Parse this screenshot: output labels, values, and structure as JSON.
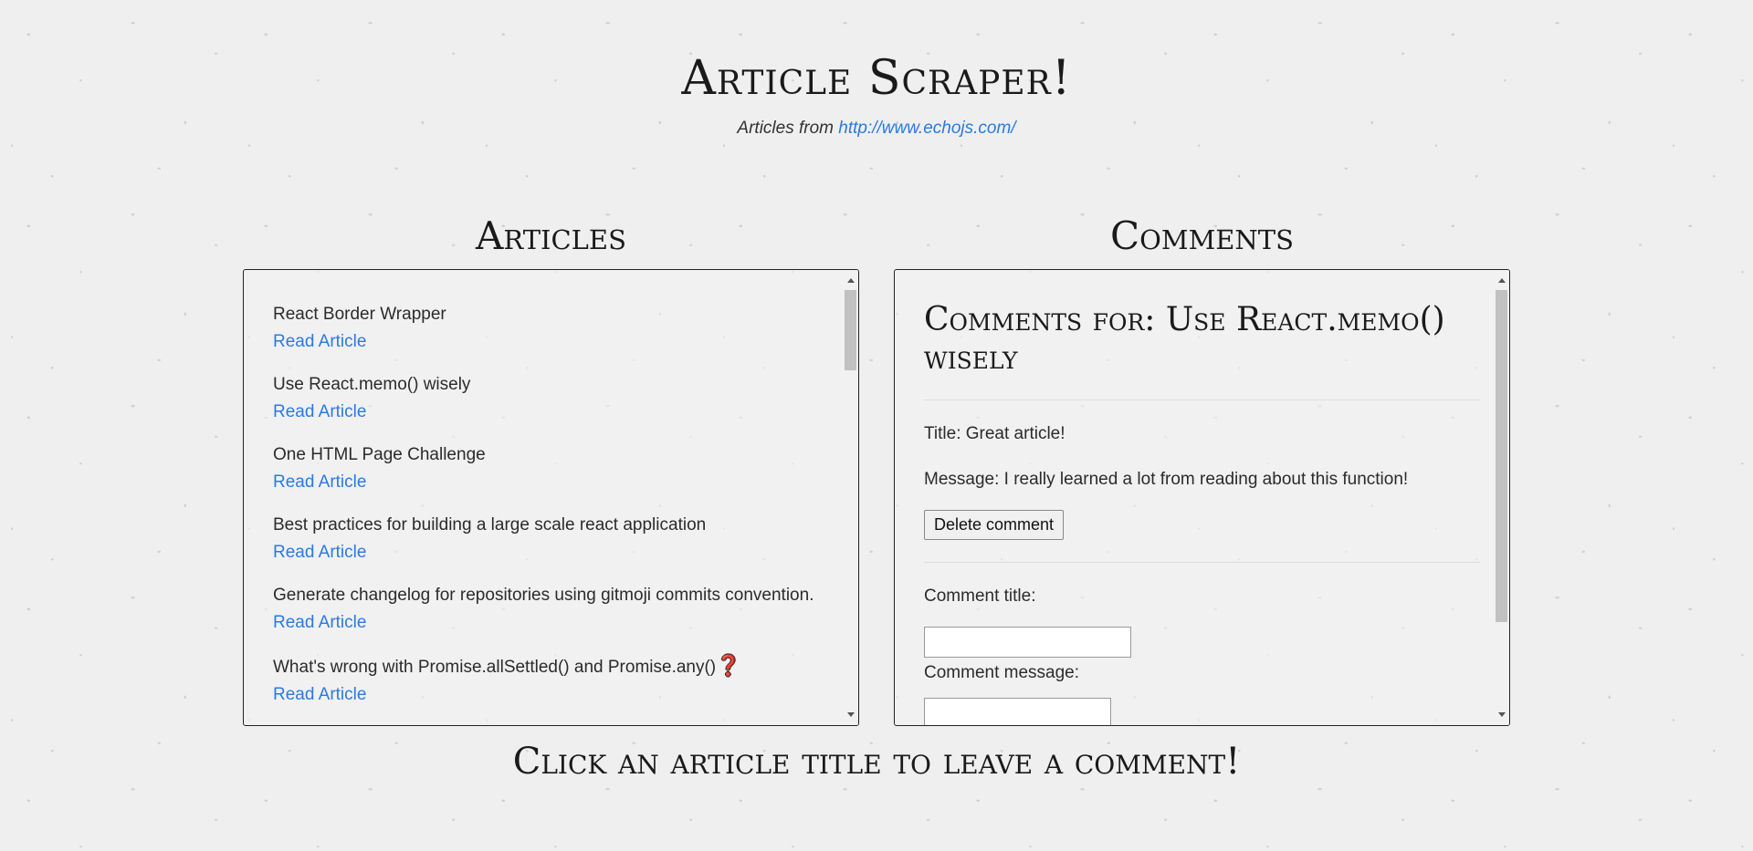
{
  "header": {
    "title": "Article Scraper!",
    "subtitle_prefix": "Articles from",
    "source_link": "http://www.echojs.com/"
  },
  "articles": {
    "heading": "Articles",
    "link_label": "Read Article",
    "items": [
      {
        "title": "React Border Wrapper",
        "link": "Read Article"
      },
      {
        "title": "Use React.memo() wisely",
        "link": "Read Article"
      },
      {
        "title": "One HTML Page Challenge",
        "link": "Read Article"
      },
      {
        "title": "Best practices for building a large scale react application",
        "link": "Read Article"
      },
      {
        "title": "Generate changelog for repositories using gitmoji commits convention.",
        "link": "Read Article"
      },
      {
        "title": "What's wrong with Promise.allSettled() and Promise.any()",
        "link": "Read Article"
      }
    ],
    "last_item_icon": "question-mark-icon",
    "last_item_icon_glyph": "❓"
  },
  "comments": {
    "heading": "Comments",
    "panel_title": "Comments for: Use React.memo() wisely",
    "entries": [
      {
        "title_line": "Title: Great article!",
        "message_line": "Message: I really learned a lot from reading about this function!",
        "delete_label": "Delete comment"
      }
    ],
    "form": {
      "title_label": "Comment title:",
      "title_value": "",
      "message_label": "Comment message:",
      "message_value": ""
    }
  },
  "footer": {
    "text": "Click an article title to leave a comment!"
  },
  "colors": {
    "link": "#2a7ae2",
    "background": "#efefef",
    "text": "#222222"
  }
}
